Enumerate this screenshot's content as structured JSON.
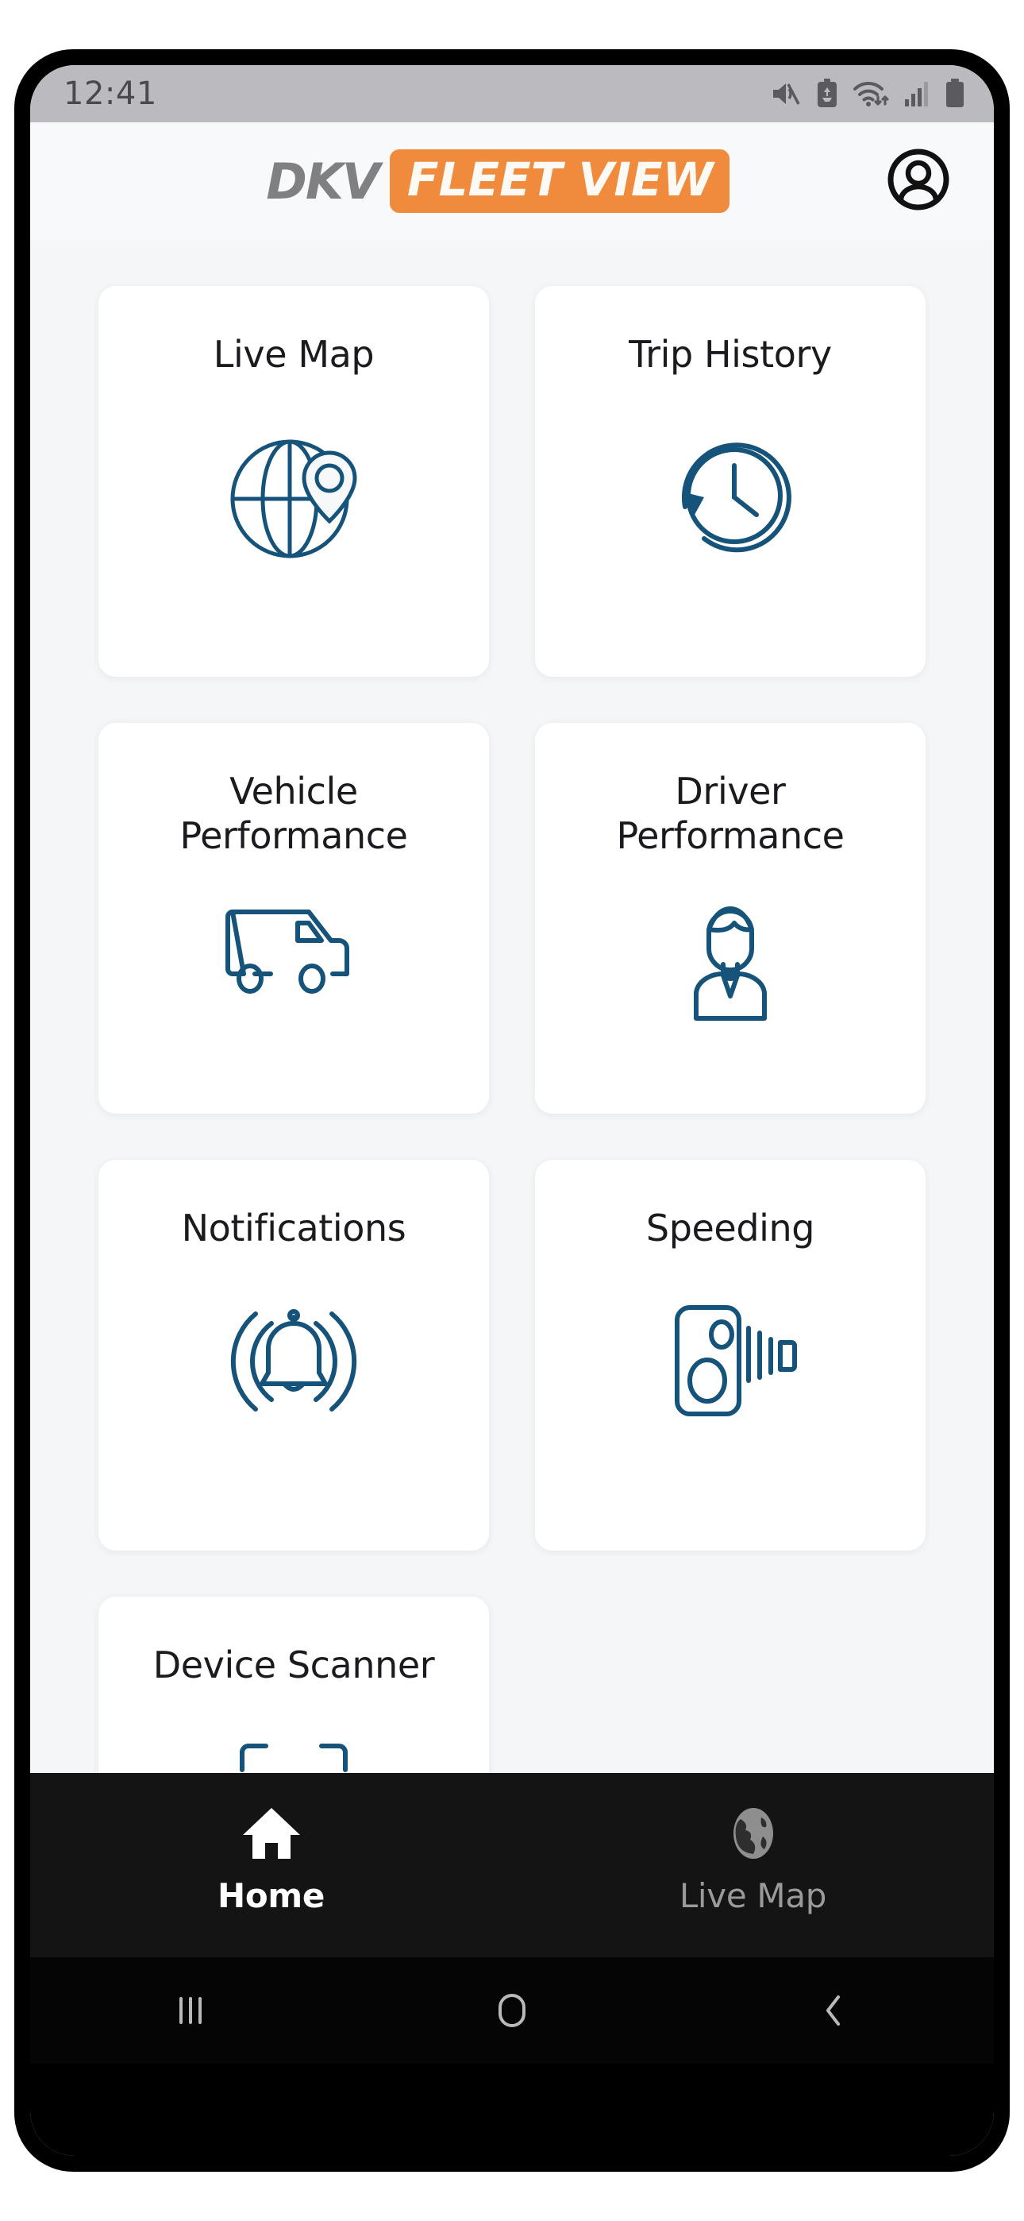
{
  "status_bar": {
    "time": "12:41",
    "icons": [
      {
        "name": "volume-mute-icon"
      },
      {
        "name": "battery-saver-icon"
      },
      {
        "name": "wifi-transfer-icon"
      },
      {
        "name": "cellular-signal-icon"
      },
      {
        "name": "battery-full-icon"
      }
    ]
  },
  "header": {
    "brand_primary": "DKV",
    "brand_secondary": "FLEET VIEW",
    "brand_accent_color": "#F08A3C",
    "brand_primary_color": "#808083",
    "account_icon": "account-circle-icon"
  },
  "main": {
    "tiles": [
      {
        "label": "Live Map",
        "icon": "globe-pin-icon",
        "lines": 1
      },
      {
        "label": "Trip History",
        "icon": "history-clock-icon",
        "lines": 1
      },
      {
        "label": "Vehicle\nPerformance",
        "icon": "van-icon",
        "lines": 2
      },
      {
        "label": "Driver\nPerformance",
        "icon": "driver-person-icon",
        "lines": 2
      },
      {
        "label": "Notifications",
        "icon": "bell-ringing-icon",
        "lines": 1
      },
      {
        "label": "Speeding",
        "icon": "speed-camera-icon",
        "lines": 1
      },
      {
        "label": "Device Scanner",
        "icon": "scanner-icon",
        "lines": 1
      }
    ],
    "icon_color": "#16537A"
  },
  "bottom_nav": {
    "items": [
      {
        "label": "Home",
        "icon": "home-icon",
        "active": true
      },
      {
        "label": "Live Map",
        "icon": "globe-nav-icon",
        "active": false
      }
    ]
  },
  "system_nav": {
    "recents_label": "|||",
    "home_label": "home",
    "back_label": "back"
  }
}
